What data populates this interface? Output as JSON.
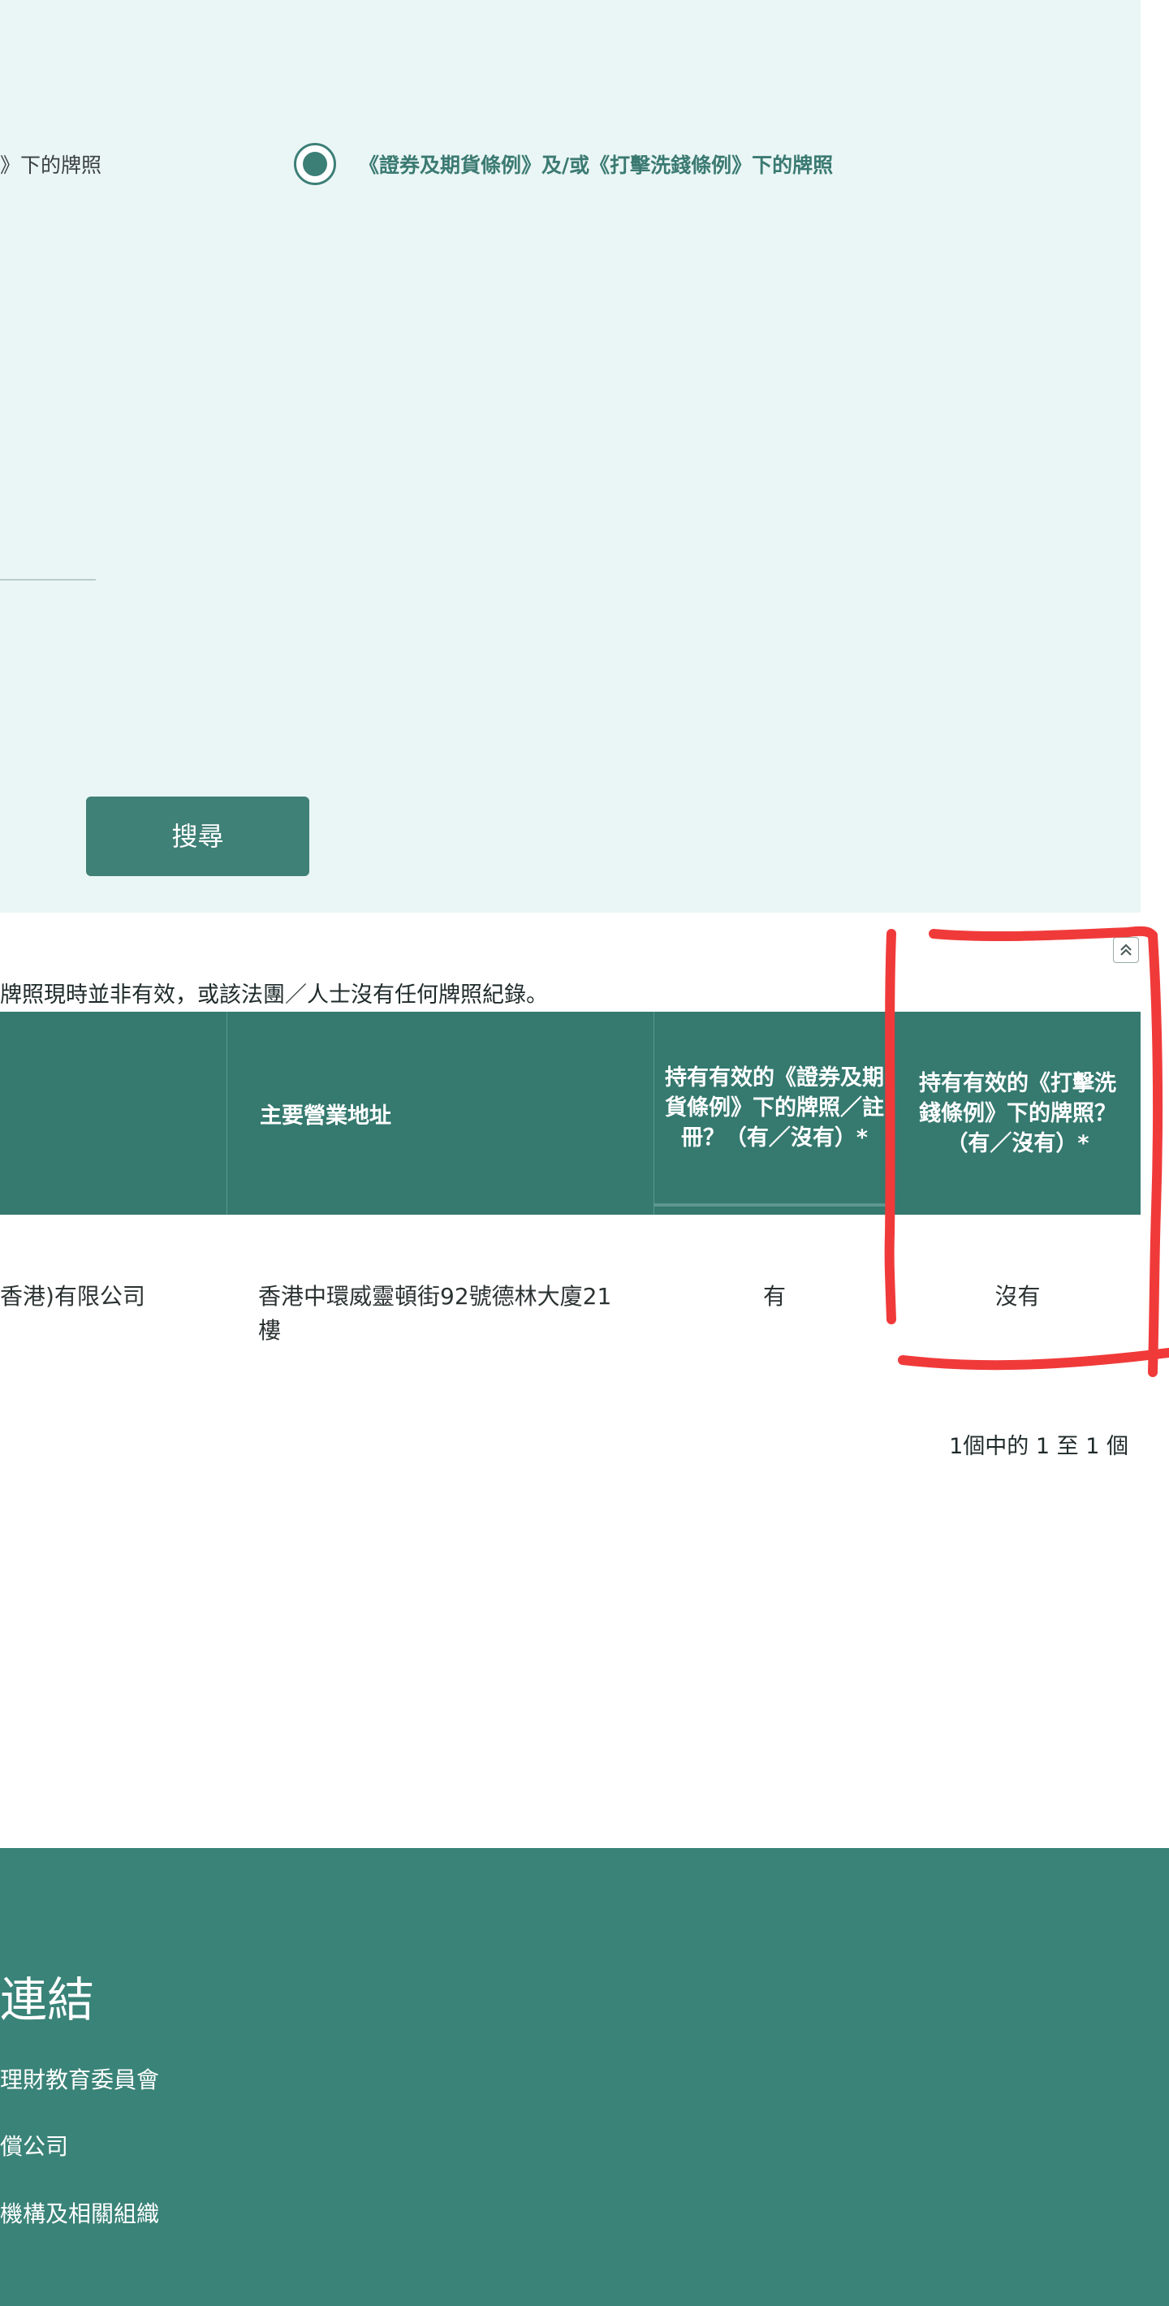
{
  "search": {
    "radio_left_label": "》下的牌照",
    "radio_right_label": "《證券及期貨條例》及/或《打擊洗錢條例》下的牌照",
    "button_label": "搜尋"
  },
  "results": {
    "notice": "牌照現時並非有效，或該法團／人士沒有任何牌照紀錄。",
    "headers": {
      "address": "主要營業地址",
      "sfo_license": "持有有效的《證券及期貨條例》下的牌照／註冊？（有／沒有）*",
      "amlo_license": "持有有效的《打擊洗錢條例》下的牌照？（有／沒有）*"
    },
    "rows": [
      {
        "name": "香港)有限公司",
        "address": "香港中環威靈頓街92號德林大廈21樓",
        "sfo": "有",
        "amlo": "沒有"
      }
    ],
    "pagination": "1個中的 1 至 1 個"
  },
  "footer": {
    "title": "連結",
    "links": [
      "理財教育委員會",
      "償公司",
      "機構及相關組織"
    ]
  },
  "colors": {
    "panel_bg": "#eaf6f5",
    "brand_teal": "#3f8077",
    "table_header": "#35796f",
    "footer_bg": "#3a8378",
    "annotation_red": "#f03a3a"
  },
  "icons": {
    "radio": "radio-selected-icon",
    "scroll_top": "double-chevron-up-icon"
  }
}
